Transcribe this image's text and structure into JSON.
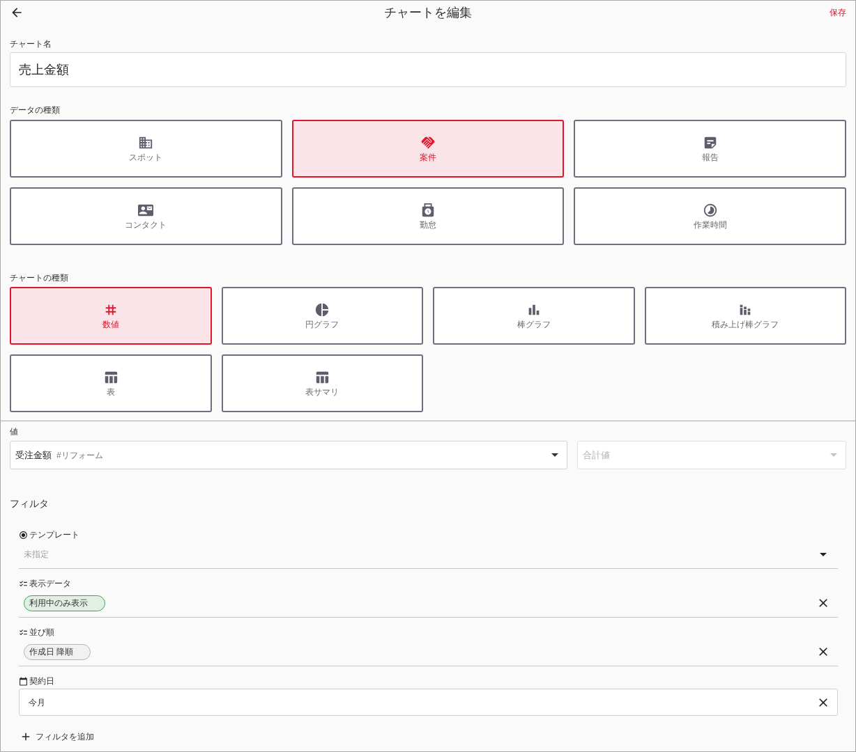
{
  "header": {
    "title": "チャートを編集",
    "action": "保存"
  },
  "chart_name": {
    "label": "チャート名",
    "value": "売上金額"
  },
  "data_type": {
    "label": "データの種類",
    "options": [
      {
        "label": "スポット",
        "selected": false
      },
      {
        "label": "案件",
        "selected": true
      },
      {
        "label": "報告",
        "selected": false
      },
      {
        "label": "コンタクト",
        "selected": false
      },
      {
        "label": "勤怠",
        "selected": false
      },
      {
        "label": "作業時間",
        "selected": false
      }
    ]
  },
  "chart_type": {
    "label": "チャートの種類",
    "options": [
      {
        "label": "数値",
        "selected": true
      },
      {
        "label": "円グラフ",
        "selected": false
      },
      {
        "label": "棒グラフ",
        "selected": false
      },
      {
        "label": "積み上げ棒グラフ",
        "selected": false
      },
      {
        "label": "表",
        "selected": false
      },
      {
        "label": "表サマリ",
        "selected": false
      }
    ]
  },
  "value": {
    "label": "値",
    "field": {
      "value": "受注金額",
      "tag": "#リフォーム"
    },
    "aggregate": {
      "value": "合計値",
      "disabled": true
    }
  },
  "filter": {
    "title": "フィルタ",
    "items": [
      {
        "kind": "select",
        "label": "テンプレート",
        "placeholder": "未指定"
      },
      {
        "kind": "chips",
        "label": "表示データ",
        "chips": [
          {
            "label": "利用中のみ表示",
            "color": "#34a853"
          }
        ]
      },
      {
        "kind": "chips",
        "label": "並び順",
        "chips": [
          {
            "label": "作成日 降順",
            "color": "#b4b4b4"
          }
        ]
      },
      {
        "kind": "date",
        "label": "契約日",
        "value": "今月"
      }
    ],
    "add": "フィルタを追加"
  }
}
